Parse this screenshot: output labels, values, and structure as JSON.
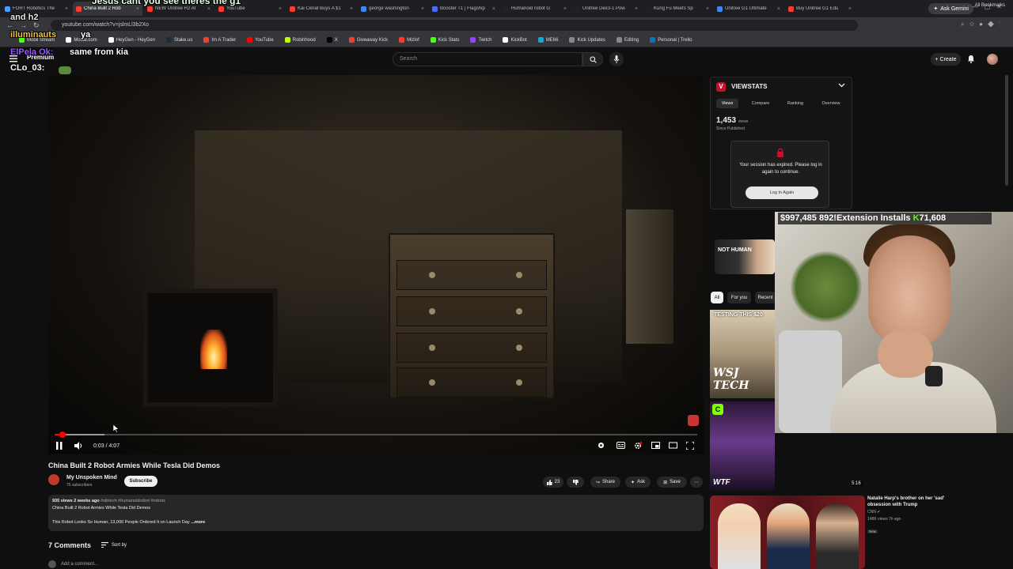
{
  "browser": {
    "tabs": [
      {
        "title": "FORT Robotics The",
        "color": "#4a9eff",
        "active": false
      },
      {
        "title": "China Built 2 Rob",
        "color": "#ff3b30",
        "active": true
      },
      {
        "title": "NEW Unitree H2 AI",
        "color": "#ff3b30",
        "active": false
      },
      {
        "title": "YouTube",
        "color": "#ff3b30",
        "active": false
      },
      {
        "title": "Kai Cenat Buys A $1",
        "color": "#ff3b30",
        "active": false
      },
      {
        "title": "george washington",
        "color": "#4285f4",
        "active": false
      },
      {
        "title": "Booster T1 | Flagship",
        "color": "#4a6cff",
        "active": false
      },
      {
        "title": "Humanoid robot G",
        "color": "#222222",
        "active": false
      },
      {
        "title": "Unitree Dex3-1 Pow",
        "color": "#222222",
        "active": false
      },
      {
        "title": "Kung Fu Meets Sp",
        "color": "#222222",
        "active": false
      },
      {
        "title": "Unitree G1 Ultimate",
        "color": "#4285f4",
        "active": false
      },
      {
        "title": "Buy Unitree G1 Edu",
        "color": "#ff3b30",
        "active": false
      }
    ],
    "gemini_label": "Ask Gemini",
    "url": "youtube.com/watch?v=jslmLl3b2Xo",
    "bookmarks": [
      {
        "label": "Mobil Stream",
        "color": "#53fc18"
      },
      {
        "label": "Modal.com",
        "color": "#ffffff"
      },
      {
        "label": "HeyGen - HeyGen",
        "color": "#ffffff"
      },
      {
        "label": "Stake.us",
        "color": "#1a2c38"
      },
      {
        "label": "Im A Trader",
        "color": "#ff3b30"
      },
      {
        "label": "YouTube",
        "color": "#ff0000"
      },
      {
        "label": "Robinhood",
        "color": "#c0ff00"
      },
      {
        "label": "X",
        "color": "#000000"
      },
      {
        "label": "Giveaway Kick",
        "color": "#ff3b30"
      },
      {
        "label": "Mizlof",
        "color": "#ff3b30"
      },
      {
        "label": "Kick Stats",
        "color": "#53fc18"
      },
      {
        "label": "Twitch",
        "color": "#9146ff"
      },
      {
        "label": "KickBot",
        "color": "#ffffff"
      },
      {
        "label": "ME66",
        "color": "#19a7ce"
      },
      {
        "label": "Kick Updates",
        "color": "#888888"
      },
      {
        "label": "Editing",
        "color": "#888888"
      },
      {
        "label": "Personal | Trello",
        "color": "#0079bf"
      }
    ],
    "all_bookmarks": "All Bookmarks"
  },
  "chat_overlay": {
    "line1": "Jesus cant you see theres the g1",
    "line2": "and h2",
    "user3": "illuminauts",
    "text3": "ya",
    "user4": "ElPela Ok:",
    "text4": "same from kia",
    "user5": "CLo_03:"
  },
  "youtube": {
    "logo_text": "Premium",
    "search_placeholder": "Search",
    "create_label": "Create",
    "video": {
      "time": "0:03 / 4:07",
      "progress_fraction": 0.012,
      "buffered_fraction": 0.077,
      "title": "China Built 2 Robot Armies While Tesla Did Demos",
      "channel": "My Unspoken Mind",
      "subscribers": "75 subscribers",
      "subscribe_label": "Subscribe",
      "likes": "23",
      "share_label": "Share",
      "ask_label": "Ask",
      "save_label": "Save",
      "desc_meta": "935 views  2 weeks ago",
      "desc_tags": "#sibtech #humanoidrobot #robots",
      "desc_line2": "China Built 2 Robot Armies While Tesla Did Demos",
      "desc_line3": "This Robot Looks So Human, 13,000 People Ordered It on Launch Day",
      "more_label": "...more",
      "comments_count": "7 Comments",
      "sort_label": "Sort by",
      "add_comment": "Add a comment..."
    }
  },
  "viewstats": {
    "title": "VIEWSTATS",
    "tabs": [
      "Views",
      "Compare",
      "Ranking",
      "Overview"
    ],
    "views": "1,453",
    "views_unit": "views",
    "since": "Since Published",
    "expired_msg": "Your session has expired. Please log in again to continue.",
    "login_label": "Log In Again"
  },
  "sidebar": {
    "promo_text": "NOT HUMAN",
    "chips": [
      "All",
      "For you",
      "Recent"
    ],
    "thumb1_title": "TESTING THIS $20",
    "thumb1_brand": "WSJ TECH",
    "thumb2_brand": "WTF",
    "thumb2_duration": "5:16",
    "news_title": "Natalie Harp's brother on her 'sad' obsession with Trump",
    "news_channel": "CNN",
    "news_meta": "148K views  7h ago",
    "news_badge": "New"
  },
  "stream": {
    "donation_total": "$997,485",
    "donation_text": "892!Extension Installs",
    "kick_total": "71,608"
  },
  "colors": {
    "yt_red": "#ff0000",
    "viewstats_red": "#c8102e",
    "kick_green": "#53fc18"
  }
}
